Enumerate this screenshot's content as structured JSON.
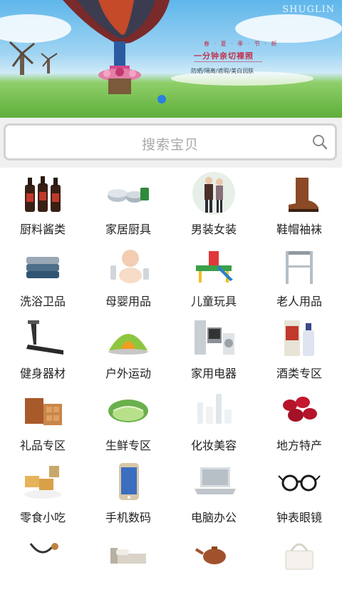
{
  "banner": {
    "brand": "SHUGLIN",
    "slogan_top": "春 · 夏 · 季 · 节 · 新",
    "slogan": "一分钟亲切裸照",
    "slogan_bottom": "防晒/隔离/遮瑕/美白润肤",
    "carousel_active_index": 0
  },
  "search": {
    "placeholder": "搜索宝贝"
  },
  "categories": [
    {
      "label": "厨料酱类",
      "icon": "soy-sauce-bottles-icon"
    },
    {
      "label": "家居厨具",
      "icon": "kitchenware-icon"
    },
    {
      "label": "男装女装",
      "icon": "couple-clothing-icon"
    },
    {
      "label": "鞋帽袖袜",
      "icon": "boot-icon"
    },
    {
      "label": "洗浴卫品",
      "icon": "towel-stack-icon"
    },
    {
      "label": "母婴用品",
      "icon": "baby-icon"
    },
    {
      "label": "儿童玩具",
      "icon": "playground-toy-icon"
    },
    {
      "label": "老人用品",
      "icon": "walker-icon"
    },
    {
      "label": "健身器材",
      "icon": "treadmill-icon"
    },
    {
      "label": "户外运动",
      "icon": "tent-icon"
    },
    {
      "label": "家用电器",
      "icon": "appliances-icon"
    },
    {
      "label": "酒类专区",
      "icon": "liquor-bottle-icon"
    },
    {
      "label": "礼品专区",
      "icon": "gift-box-icon"
    },
    {
      "label": "生鲜专区",
      "icon": "vegetable-icon"
    },
    {
      "label": "化妆美容",
      "icon": "cosmetics-icon"
    },
    {
      "label": "地方特产",
      "icon": "red-dates-icon"
    },
    {
      "label": "零食小吃",
      "icon": "snack-icon"
    },
    {
      "label": "手机数码",
      "icon": "smartphone-icon"
    },
    {
      "label": "电脑办公",
      "icon": "laptop-icon"
    },
    {
      "label": "钟表眼镜",
      "icon": "glasses-icon"
    },
    {
      "label": "",
      "icon": "stethoscope-icon"
    },
    {
      "label": "",
      "icon": "bed-icon"
    },
    {
      "label": "",
      "icon": "teapot-icon"
    },
    {
      "label": "",
      "icon": "handbag-icon"
    }
  ],
  "colors": {
    "accent": "#2b7fe0",
    "search_border": "#d2d2d2",
    "search_bg": "#f0f0f0",
    "placeholder": "#a8a8a8",
    "label": "#222222"
  }
}
